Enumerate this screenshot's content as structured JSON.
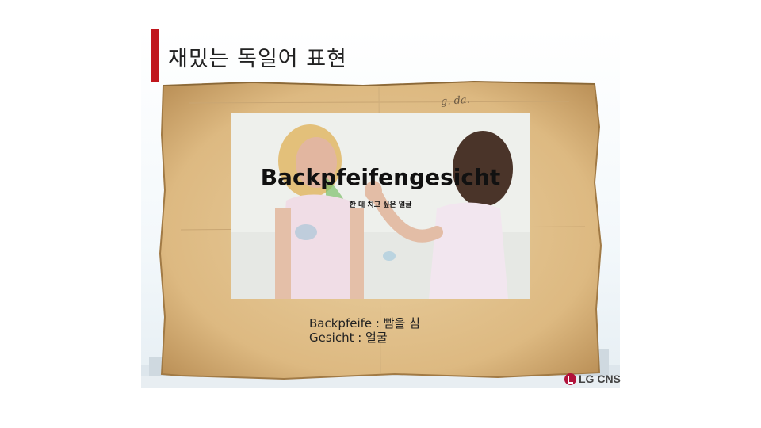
{
  "slide": {
    "title": "재밌는 독일어 표현",
    "accent_color": "#c0161d"
  },
  "paper": {
    "handwriting": "g. da."
  },
  "photo": {
    "headline": "Backpfeifengesicht",
    "subtitle": "한 대 치고 싶은 얼굴"
  },
  "definitions": [
    "Backpfeife : 빰을 침",
    "Gesicht : 얼굴"
  ],
  "logo": {
    "text": "LG CNS",
    "color": "#b1123b"
  }
}
